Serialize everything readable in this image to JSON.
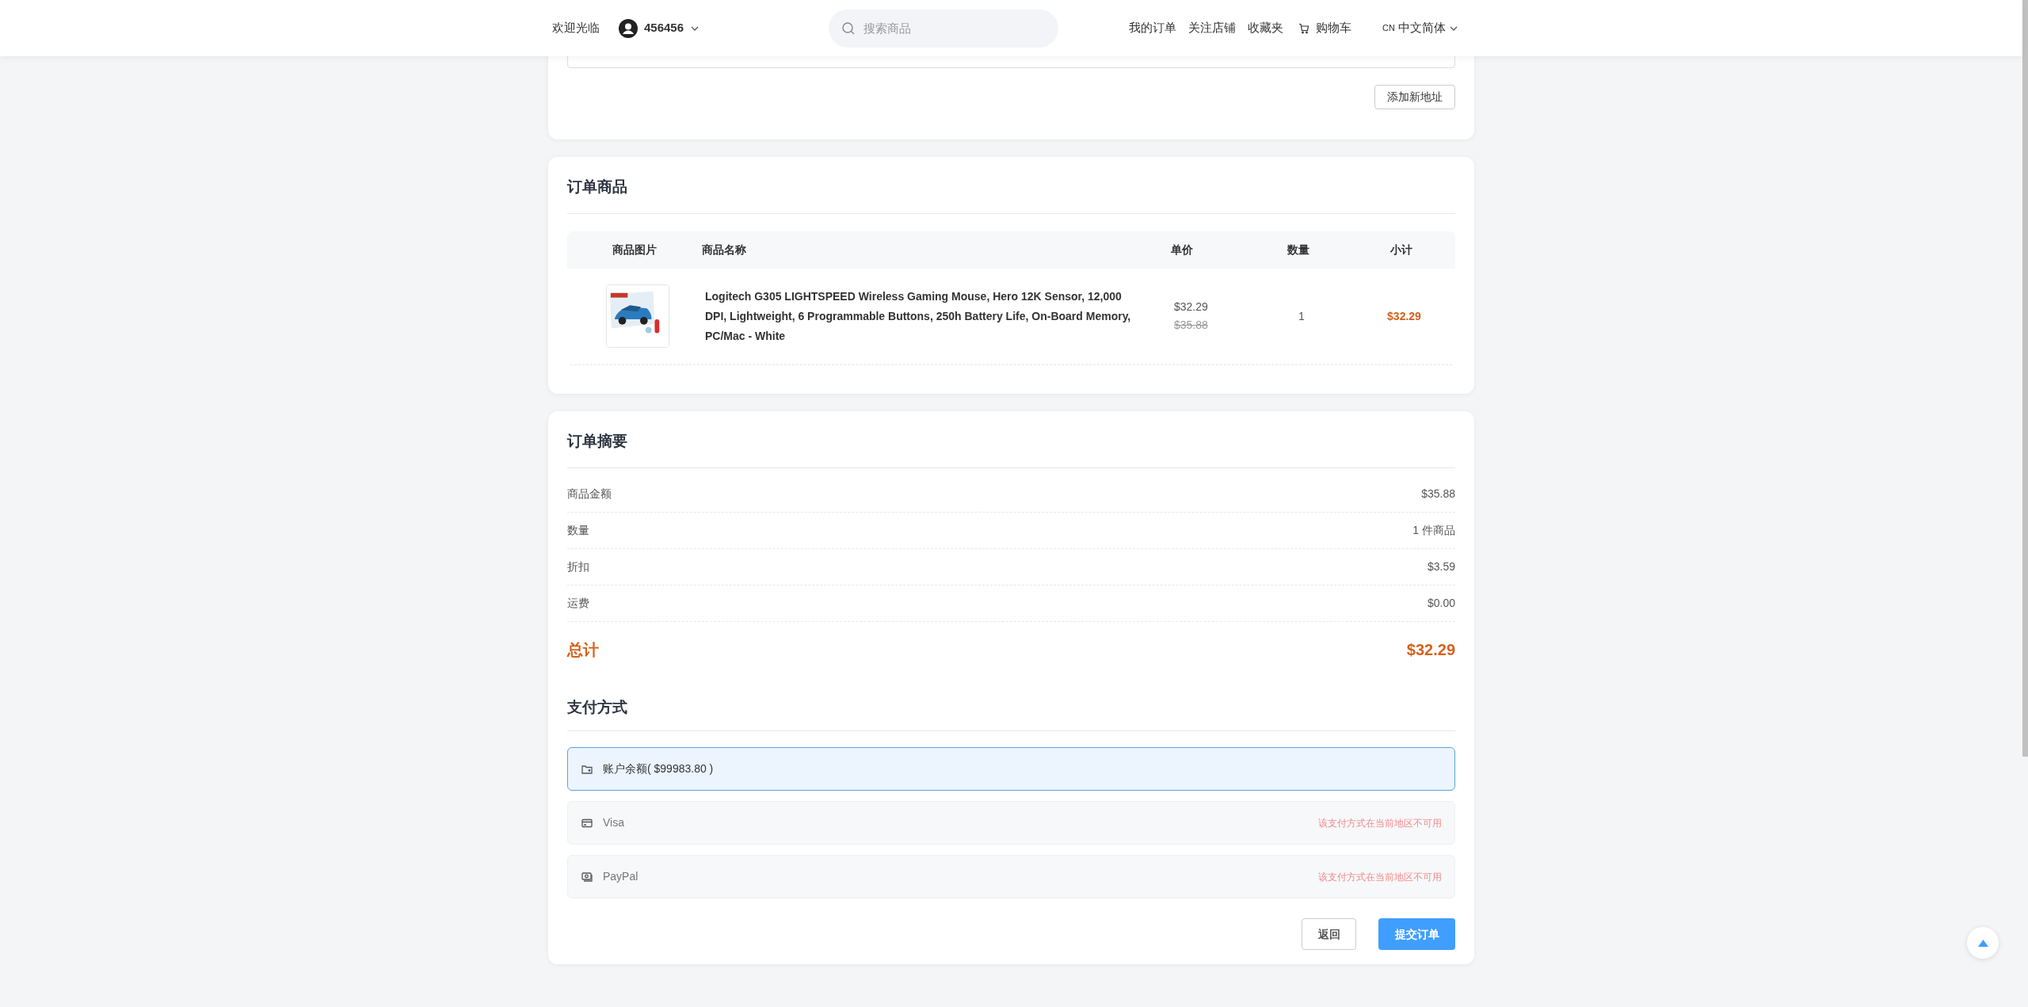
{
  "header": {
    "welcome": "欢迎光临",
    "username": "456456",
    "search": {
      "placeholder": "搜索商品"
    },
    "links": [
      "我的订单",
      "关注店铺",
      "收藏夹"
    ],
    "cart": "购物车",
    "language": {
      "code": "CN",
      "label": "中文简体"
    }
  },
  "address_card": {
    "add_button": "添加新地址"
  },
  "order_items": {
    "title": "订单商品",
    "columns": [
      "商品图片",
      "商品名称",
      "单价",
      "数量",
      "小计"
    ],
    "rows": [
      {
        "name": "Logitech G305 LIGHTSPEED Wireless Gaming Mouse, Hero 12K Sensor, 12,000 DPI, Lightweight, 6 Programmable Buttons, 250h Battery Life, On-Board Memory, PC/Mac - White",
        "price": "$32.29",
        "original_price": "$35.88",
        "quantity": "1",
        "subtotal": "$32.29"
      }
    ]
  },
  "summary": {
    "title": "订单摘要",
    "rows": [
      {
        "label": "商品金额",
        "value": "$35.88"
      },
      {
        "label": "数量",
        "value": "1 件商品"
      },
      {
        "label": "折扣",
        "value": "$3.59"
      },
      {
        "label": "运费",
        "value": "$0.00"
      }
    ],
    "total": {
      "label": "总计",
      "value": "$32.29"
    }
  },
  "payment": {
    "title": "支付方式",
    "methods": [
      {
        "kind": "balance",
        "label": "账户余额( $99983.80 )",
        "selected": true,
        "disabled": false
      },
      {
        "kind": "card",
        "label": "Visa",
        "selected": false,
        "disabled": true,
        "notice": "该支付方式在当前地区不可用"
      },
      {
        "kind": "paypal",
        "label": "PayPal",
        "selected": false,
        "disabled": true,
        "notice": "该支付方式在当前地区不可用"
      }
    ]
  },
  "buttons": {
    "back": "返回",
    "submit": "提交订单"
  }
}
